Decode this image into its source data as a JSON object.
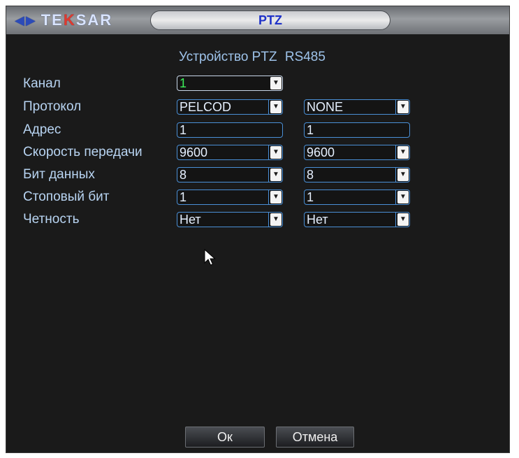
{
  "window": {
    "logo_text": "TEKSAR",
    "logo_left_glyph": "◀▶",
    "title": "PTZ"
  },
  "header": {
    "device_label": "Устройство PTZ",
    "device_label2": "RS485"
  },
  "rows": [
    {
      "label": "Канал",
      "col1": "1",
      "col2": null
    },
    {
      "label": "Протокол",
      "col1": "PELCOD",
      "col2": "NONE"
    },
    {
      "label": "Адрес",
      "col1": "1",
      "col2": "1"
    },
    {
      "label": "Скорость передачи",
      "col1": "9600",
      "col2": "9600"
    },
    {
      "label": "Бит данных",
      "col1": "8",
      "col2": "8"
    },
    {
      "label": "Стоповый бит",
      "col1": "1",
      "col2": "1"
    },
    {
      "label": "Четность",
      "col1": "Нет",
      "col2": "Нет"
    }
  ],
  "buttons": {
    "ok": "Ок",
    "cancel": "Отмена"
  },
  "colors": {
    "accent_border": "#4a8fd6",
    "channel_value": "#3df05a",
    "title_text": "#1f32c8"
  }
}
